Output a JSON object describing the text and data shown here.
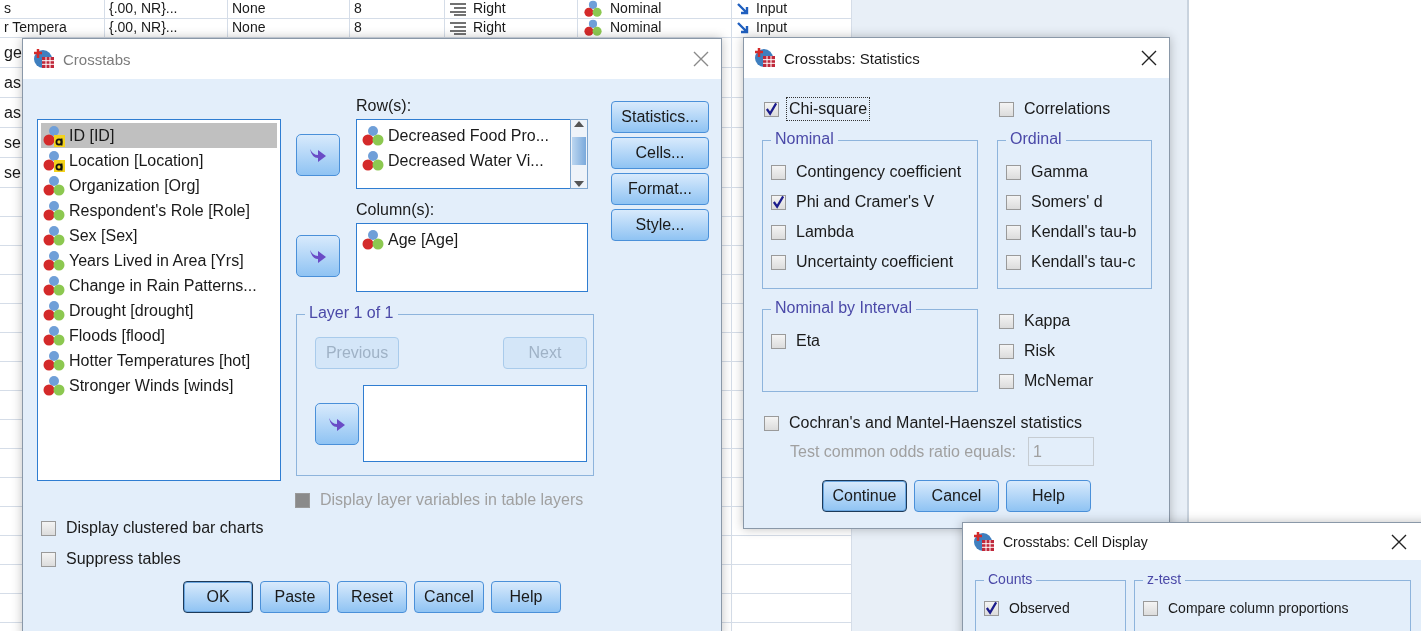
{
  "grid": {
    "rows": [
      {
        "cells": [
          "s",
          "{.00, NR}...",
          "None",
          "8",
          "Right",
          "Nominal",
          "Input"
        ]
      },
      {
        "cells": [
          "r Tempera",
          "{.00, NR}...",
          "None",
          "8",
          "Right",
          "Nominal",
          "Input"
        ]
      },
      {
        "cells": [
          "ge"
        ]
      },
      {
        "cells": [
          "as"
        ]
      },
      {
        "cells": [
          "as"
        ]
      },
      {
        "cells": [
          "se"
        ]
      },
      {
        "cells": [
          "se"
        ]
      }
    ]
  },
  "crosstabs": {
    "title": "Crosstabs",
    "variables": [
      {
        "label": "ID [ID]",
        "kind": "string",
        "selected": true
      },
      {
        "label": "Location [Location]",
        "kind": "string",
        "selected": false
      },
      {
        "label": "Organization [Org]",
        "kind": "nominal",
        "selected": false
      },
      {
        "label": "Respondent's Role [Role]",
        "kind": "nominal",
        "selected": false
      },
      {
        "label": "Sex [Sex]",
        "kind": "nominal",
        "selected": false
      },
      {
        "label": "Years Lived in Area [Yrs]",
        "kind": "nominal",
        "selected": false
      },
      {
        "label": "Change in Rain Patterns...",
        "kind": "nominal",
        "selected": false
      },
      {
        "label": "Drought [drought]",
        "kind": "nominal",
        "selected": false
      },
      {
        "label": "Floods [flood]",
        "kind": "nominal",
        "selected": false
      },
      {
        "label": "Hotter Temperatures [hot]",
        "kind": "nominal",
        "selected": false
      },
      {
        "label": "Stronger Winds [winds]",
        "kind": "nominal",
        "selected": false
      }
    ],
    "rows_label": "Row(s):",
    "rows": [
      {
        "label": "Decreased Food Pro...",
        "kind": "nominal"
      },
      {
        "label": "Decreased Water Vi...",
        "kind": "nominal"
      }
    ],
    "columns_label": "Column(s):",
    "columns": [
      {
        "label": "Age [Age]",
        "kind": "nominal"
      }
    ],
    "layer": {
      "legend": "Layer 1 of 1",
      "previous": {
        "label": "Previous",
        "disabled": true
      },
      "next": {
        "label": "Next",
        "disabled": true
      }
    },
    "display_layer": {
      "label": "Display layer variables in table layers",
      "checked": false,
      "disabled": true
    },
    "side_buttons": [
      "Statistics...",
      "Cells...",
      "Format...",
      "Style..."
    ],
    "options": [
      {
        "label": "Display clustered bar charts",
        "checked": false
      },
      {
        "label": "Suppress tables",
        "checked": false
      }
    ],
    "buttons": [
      {
        "label": "OK",
        "default": true
      },
      {
        "label": "Paste",
        "default": false
      },
      {
        "label": "Reset",
        "default": false
      },
      {
        "label": "Cancel",
        "default": false
      },
      {
        "label": "Help",
        "default": false
      }
    ]
  },
  "statistics": {
    "title": "Crosstabs: Statistics",
    "top": [
      {
        "label": "Chi-square",
        "checked": true,
        "focused": true
      },
      {
        "label": "Correlations",
        "checked": false
      }
    ],
    "groups": [
      {
        "legend": "Nominal",
        "items": [
          {
            "label": "Contingency coefficient",
            "checked": false
          },
          {
            "label": "Phi and Cramer's V",
            "checked": true
          },
          {
            "label": "Lambda",
            "checked": false
          },
          {
            "label": "Uncertainty coefficient",
            "checked": false
          }
        ]
      },
      {
        "legend": "Ordinal",
        "items": [
          {
            "label": "Gamma",
            "checked": false
          },
          {
            "label": "Somers' d",
            "checked": false
          },
          {
            "label": "Kendall's tau-b",
            "checked": false
          },
          {
            "label": "Kendall's tau-c",
            "checked": false
          }
        ]
      },
      {
        "legend": "Nominal by Interval",
        "items": [
          {
            "label": "Eta",
            "checked": false
          }
        ]
      }
    ],
    "extra": [
      {
        "label": "Kappa",
        "checked": false
      },
      {
        "label": "Risk",
        "checked": false
      },
      {
        "label": "McNemar",
        "checked": false
      }
    ],
    "cochran": {
      "label": "Cochran's and Mantel-Haenszel statistics",
      "checked": false
    },
    "odds": {
      "label": "Test common odds ratio equals:",
      "value": "1",
      "disabled": true
    },
    "buttons": [
      {
        "label": "Continue",
        "default": true
      },
      {
        "label": "Cancel",
        "default": false
      },
      {
        "label": "Help",
        "default": false
      }
    ]
  },
  "cell_display": {
    "title": "Crosstabs: Cell Display",
    "groups": [
      {
        "legend": "Counts",
        "items": [
          {
            "label": "Observed",
            "checked": true
          }
        ]
      },
      {
        "legend": "z-test",
        "items": [
          {
            "label": "Compare column proportions",
            "checked": false
          }
        ]
      }
    ]
  }
}
